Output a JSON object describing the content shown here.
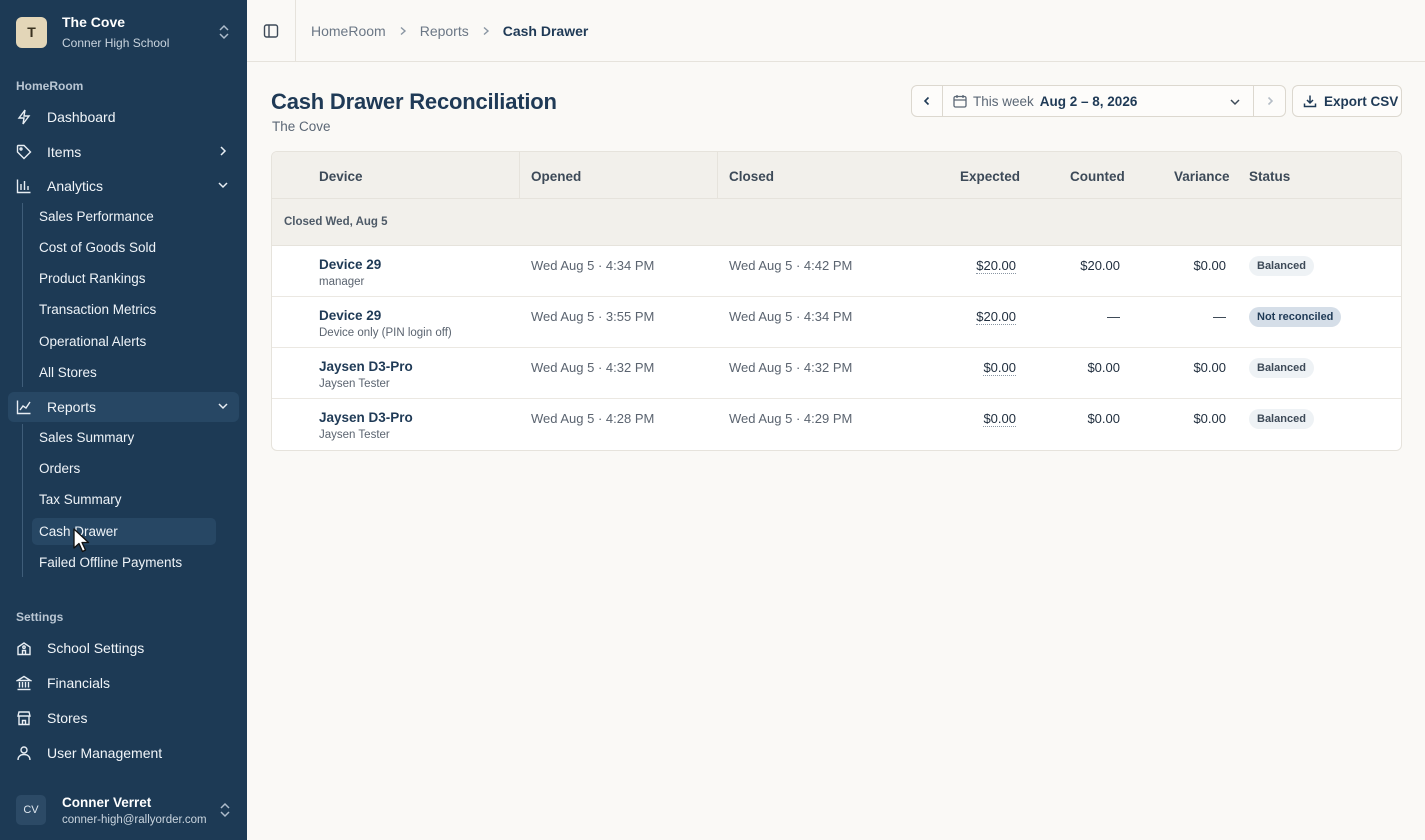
{
  "org": {
    "initial": "T",
    "name": "The Cove",
    "school": "Conner High School"
  },
  "sidebar": {
    "section_homeroom": "HomeRoom",
    "dashboard": "Dashboard",
    "items": "Items",
    "analytics": "Analytics",
    "analytics_items": [
      "Sales Performance",
      "Cost of Goods Sold",
      "Product Rankings",
      "Transaction Metrics",
      "Operational Alerts",
      "All Stores"
    ],
    "reports": "Reports",
    "reports_items": [
      "Sales Summary",
      "Orders",
      "Tax Summary",
      "Cash Drawer",
      "Failed Offline Payments"
    ],
    "section_settings": "Settings",
    "settings_items": [
      "School Settings",
      "Financials",
      "Stores",
      "User Management"
    ]
  },
  "user": {
    "initials": "CV",
    "name": "Conner Verret",
    "email": "conner-high@rallyorder.com"
  },
  "breadcrumb": [
    "HomeRoom",
    "Reports",
    "Cash Drawer"
  ],
  "page": {
    "title": "Cash Drawer Reconciliation",
    "subtitle": "The Cove"
  },
  "date_picker": {
    "label": "This week",
    "value": "Aug 2 – 8, 2026"
  },
  "export_label": "Export CSV",
  "table": {
    "headers": {
      "device": "Device",
      "opened": "Opened",
      "closed": "Closed",
      "expected": "Expected",
      "counted": "Counted",
      "variance": "Variance",
      "status": "Status"
    },
    "group_label": "Closed Wed, Aug 5",
    "rows": [
      {
        "device": "Device 29",
        "user": "manager",
        "opened": "Wed Aug 5 · 4:34 PM",
        "closed": "Wed Aug 5 · 4:42 PM",
        "expected": "$20.00",
        "counted": "$20.00",
        "variance": "$0.00",
        "status": "Balanced"
      },
      {
        "device": "Device 29",
        "user": "Device only (PIN login off)",
        "opened": "Wed Aug 5 · 3:55 PM",
        "closed": "Wed Aug 5 · 4:34 PM",
        "expected": "$20.00",
        "counted": "—",
        "variance": "—",
        "status": "Not reconciled"
      },
      {
        "device": "Jaysen D3-Pro",
        "user": "Jaysen Tester",
        "opened": "Wed Aug 5 · 4:32 PM",
        "closed": "Wed Aug 5 · 4:32 PM",
        "expected": "$0.00",
        "counted": "$0.00",
        "variance": "$0.00",
        "status": "Balanced"
      },
      {
        "device": "Jaysen D3-Pro",
        "user": "Jaysen Tester",
        "opened": "Wed Aug 5 · 4:28 PM",
        "closed": "Wed Aug 5 · 4:29 PM",
        "expected": "$0.00",
        "counted": "$0.00",
        "variance": "$0.00",
        "status": "Balanced"
      }
    ]
  },
  "colors": {
    "sidebar_bg": "#1d3a55",
    "sidebar_active": "#274764",
    "accent_text": "#1f3a56",
    "page_bg": "#faf9f6"
  }
}
